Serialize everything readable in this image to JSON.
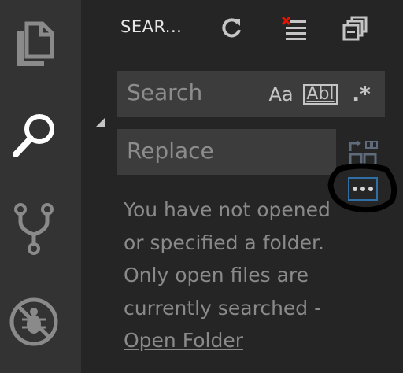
{
  "activity_bar": {
    "items": [
      {
        "name": "explorer-icon"
      },
      {
        "name": "search-icon"
      },
      {
        "name": "source-control-icon"
      },
      {
        "name": "debug-disabled-icon"
      }
    ]
  },
  "sidebar": {
    "title": "SEAR...",
    "toolbar": [
      "refresh-icon",
      "clear-results-icon",
      "collapse-all-icon"
    ]
  },
  "search": {
    "placeholder": "Search",
    "options": {
      "match_case": "Aa",
      "whole_word": "Abl",
      "regex": ".*"
    }
  },
  "replace": {
    "placeholder": "Replace"
  },
  "message": {
    "line1": "You have not opened",
    "line2": "or specified a folder.",
    "line3": "Only open files are",
    "line4": "currently searched -",
    "link": "Open Folder"
  },
  "colors": {
    "activity_bg": "#333333",
    "sidebar_bg": "#252526",
    "input_bg": "#3c3c3c",
    "focus_border": "#2f6fa5"
  }
}
